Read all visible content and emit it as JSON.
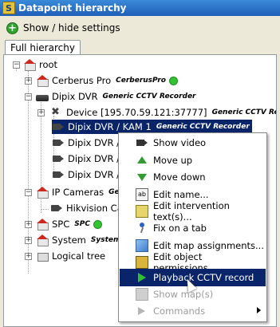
{
  "window": {
    "title": "Datapoint hierarchy",
    "app_icon": "S"
  },
  "toolbar": {
    "settings_label": "Show / hide settings"
  },
  "tabs": {
    "active": "Full hierarchy"
  },
  "tree": {
    "root": "root",
    "items": {
      "cerberus": {
        "label": "Cerberus Pro",
        "extra": "CerberusPro",
        "status": "green"
      },
      "dipix": {
        "label": "Dipix DVR",
        "extra": "Generic CCTV Recorder"
      },
      "device": {
        "label": "Device [195.70.59.121:37777]",
        "extra": "Generic CCTV Recorder"
      },
      "kam1": {
        "label": "Dipix DVR / KAM 1",
        "extra": "Generic CCTV Recorder"
      },
      "k2": {
        "label": "Dipix DVR / K"
      },
      "k3": {
        "label": "Dipix DVR / K"
      },
      "k4": {
        "label": "Dipix DVR / K"
      },
      "ipcams": {
        "label": "IP Cameras",
        "extra": "Gen"
      },
      "hikvision": {
        "label": "Hikvision Can"
      },
      "spc": {
        "label": "SPC",
        "extra": "SPC",
        "status": "green"
      },
      "system": {
        "label": "System",
        "extra": "System"
      },
      "logical": {
        "label": "Logical tree"
      }
    }
  },
  "context_menu": {
    "items": [
      {
        "label": "Show video",
        "icon": "camera-icon",
        "enabled": true
      },
      {
        "label": "Move up",
        "icon": "arrow-up-icon",
        "enabled": true
      },
      {
        "label": "Move down",
        "icon": "arrow-down-icon",
        "enabled": true
      },
      {
        "label": "Edit name...",
        "icon": "rename-icon",
        "enabled": true
      },
      {
        "label": "Edit intervention text(s)...",
        "icon": "note-icon",
        "enabled": true
      },
      {
        "label": "Fix on a tab",
        "icon": "pin-icon",
        "enabled": true
      },
      {
        "label": "Edit map assignments...",
        "icon": "map-icon",
        "enabled": true
      },
      {
        "label": "Edit object permissions...",
        "icon": "lock-icon",
        "enabled": true
      },
      {
        "label": "Playback CCTV record",
        "icon": "play-icon",
        "enabled": true,
        "highlighted": true
      },
      {
        "label": "Show map(s)",
        "icon": "map-icon",
        "enabled": false
      },
      {
        "label": "Commands",
        "icon": "command-icon",
        "enabled": false,
        "submenu": true
      }
    ]
  }
}
